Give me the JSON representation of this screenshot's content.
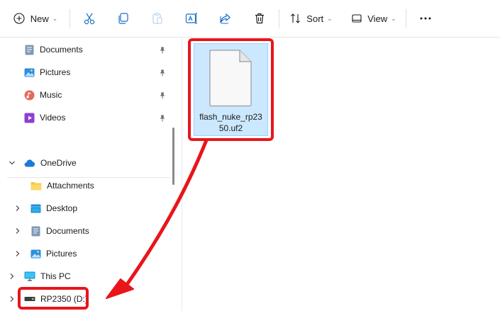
{
  "toolbar": {
    "new_label": "New",
    "sort_label": "Sort",
    "view_label": "View",
    "icons": [
      "new-icon",
      "cut-icon",
      "copy-icon",
      "paste-icon",
      "rename-icon",
      "share-icon",
      "delete-icon",
      "sort-icon",
      "view-icon",
      "more-icon"
    ]
  },
  "sidebar": {
    "quick_access": [
      {
        "label": "Documents",
        "icon": "documents-icon",
        "pinned": true
      },
      {
        "label": "Pictures",
        "icon": "pictures-icon",
        "pinned": true
      },
      {
        "label": "Music",
        "icon": "music-icon",
        "pinned": true
      },
      {
        "label": "Videos",
        "icon": "videos-icon",
        "pinned": true
      }
    ],
    "onedrive": {
      "label": "OneDrive",
      "expanded": true,
      "children": [
        {
          "label": "Attachments"
        },
        {
          "label": "Desktop"
        },
        {
          "label": "Documents"
        },
        {
          "label": "Pictures"
        }
      ]
    },
    "this_pc": {
      "label": "This PC"
    },
    "drive": {
      "label": "RP2350 (D:)"
    }
  },
  "content": {
    "file": {
      "name": "flash_nuke_rp2350.uf2",
      "selected": true
    }
  },
  "colors": {
    "selection": "#cce8ff",
    "selection_border": "#99d1ff",
    "annotation": "#e8151b",
    "folder": "#f5c64a",
    "onedrive": "#1e7ad6"
  }
}
